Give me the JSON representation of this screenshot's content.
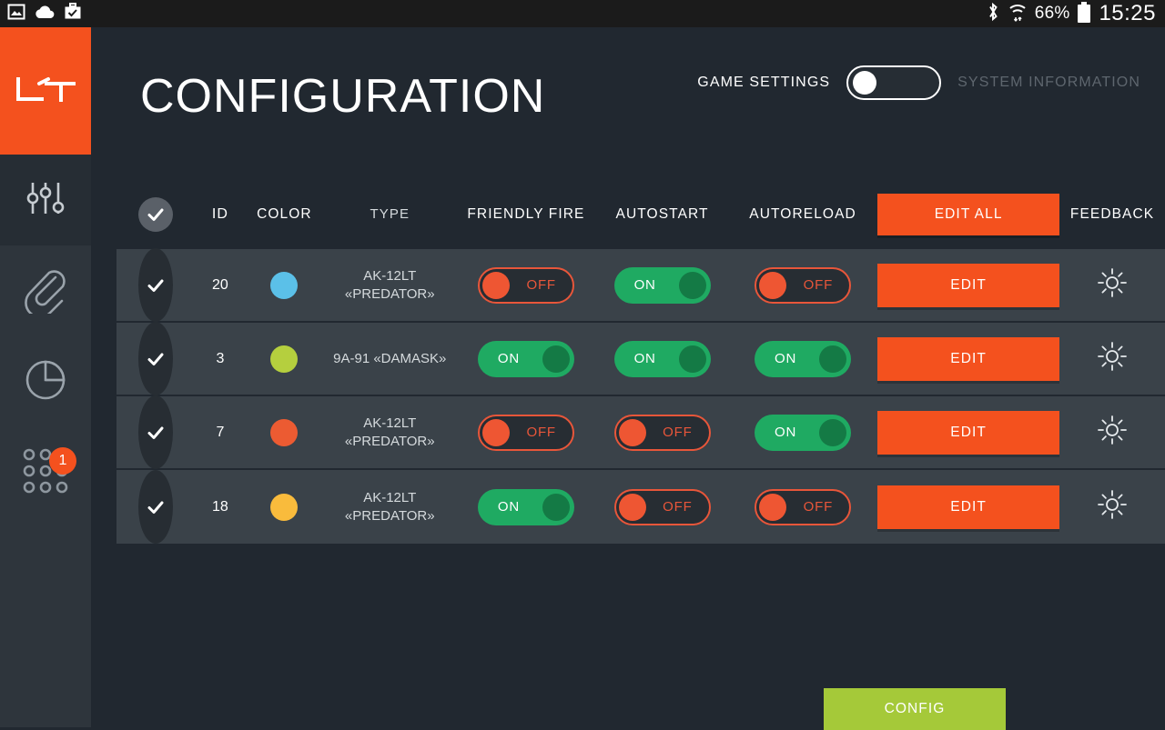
{
  "statusbar": {
    "left_icons": [
      "image-icon",
      "cloud-upload-icon",
      "briefcase-check-icon"
    ],
    "bluetooth_icon": "bluetooth-icon",
    "wifi_icon": "wifi-icon",
    "battery_percent": "66%",
    "battery_icon": "battery-icon",
    "clock": "15:25"
  },
  "sidebar": {
    "logo_text": "LT",
    "items": [
      {
        "name": "sliders-icon",
        "active": true
      },
      {
        "name": "paperclip-icon",
        "active": false
      },
      {
        "name": "pie-chart-icon",
        "active": false
      },
      {
        "name": "grid-dots-icon",
        "active": false,
        "badge": "1"
      }
    ]
  },
  "header": {
    "title": "CONFIGURATION",
    "mode_left_label": "GAME SETTINGS",
    "mode_right_label": "SYSTEM INFORMATION",
    "mode_selected": "GAME SETTINGS"
  },
  "table": {
    "columns": {
      "id": "ID",
      "color": "COLOR",
      "type": "TYPE",
      "friendly_fire": "FRIENDLY FIRE",
      "autostart": "AUTOSTART",
      "autoreload": "AUTORELOAD",
      "edit_all": "EDIT ALL",
      "feedback": "FEEDBACK"
    },
    "select_all_checked": true,
    "row_button_label": "EDIT",
    "feedback_icon": "sun-brightness-icon",
    "rows": [
      {
        "checked": true,
        "id": "20",
        "color": "#5bc0e8",
        "type": "AK-12LT\n«PREDATOR»",
        "type_line1": "AK-12LT",
        "type_line2": "«PREDATOR»",
        "friendly_fire": "OFF",
        "autostart": "ON",
        "autoreload": "OFF"
      },
      {
        "checked": true,
        "id": "3",
        "color": "#b5cf3e",
        "type": "9A-91 «DAMASK»",
        "type_line1": "9A-91 «DAMASK»",
        "type_line2": "",
        "friendly_fire": "ON",
        "autostart": "ON",
        "autoreload": "ON"
      },
      {
        "checked": true,
        "id": "7",
        "color": "#ec5b32",
        "type": "AK-12LT\n«PREDATOR»",
        "type_line1": "AK-12LT",
        "type_line2": "«PREDATOR»",
        "friendly_fire": "OFF",
        "autostart": "OFF",
        "autoreload": "ON"
      },
      {
        "checked": true,
        "id": "18",
        "color": "#f9bb3c",
        "type": "AK-12LT\n«PREDATOR»",
        "type_line1": "AK-12LT",
        "type_line2": "«PREDATOR»",
        "friendly_fire": "ON",
        "autostart": "OFF",
        "autoreload": "OFF"
      }
    ]
  },
  "footer": {
    "config_label": "CONFIG"
  },
  "colors": {
    "accent_orange": "#f4511e",
    "green_on": "#1faa62",
    "red_off": "#e8563a",
    "config_green": "#a5c939",
    "row_bg": "#3a4249",
    "page_bg": "#212830",
    "sidebar_bg": "#2e353c"
  }
}
